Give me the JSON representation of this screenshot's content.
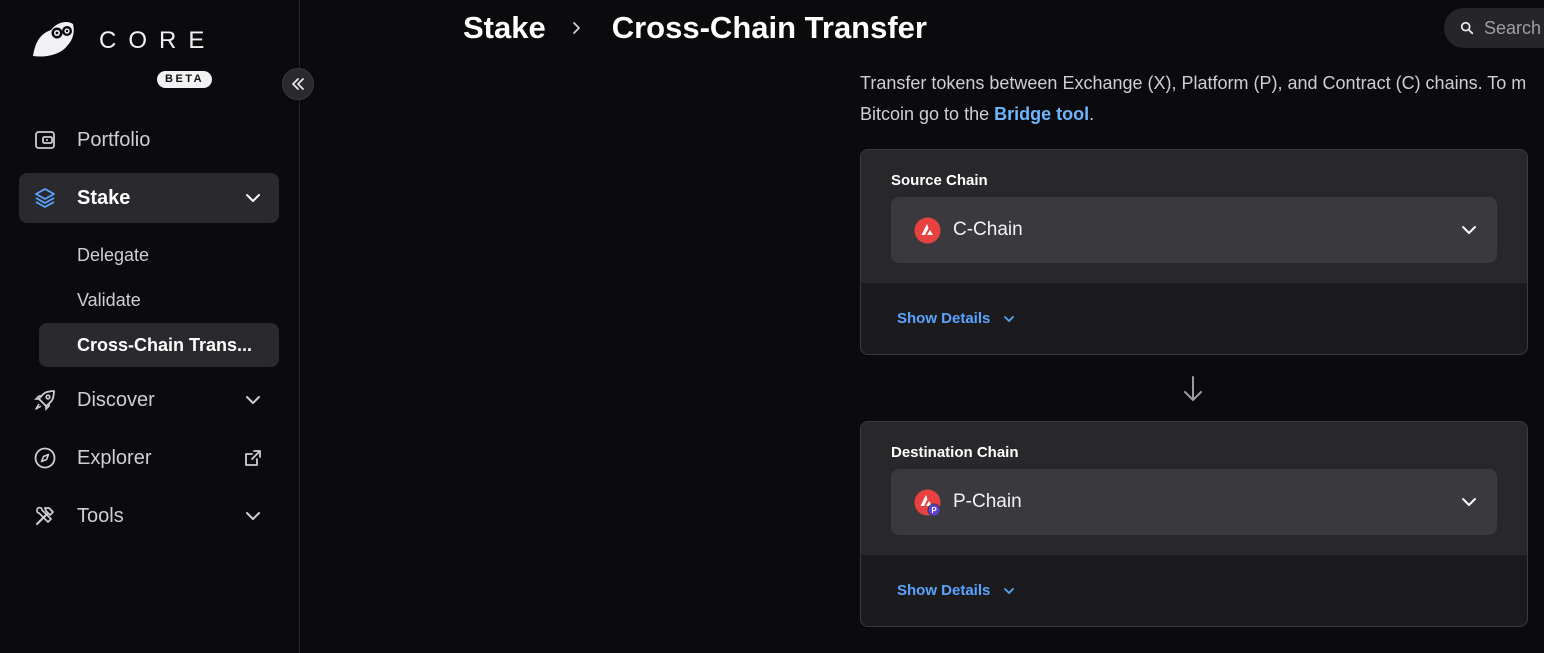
{
  "brand": {
    "name": "CORE",
    "badge": "BETA"
  },
  "sidebar": {
    "items": [
      {
        "label": "Portfolio",
        "icon": "wallet-icon"
      },
      {
        "label": "Stake",
        "icon": "layers-icon",
        "expanded": true,
        "subitems": [
          {
            "label": "Delegate"
          },
          {
            "label": "Validate"
          },
          {
            "label": "Cross-Chain Trans..."
          }
        ]
      },
      {
        "label": "Discover",
        "icon": "rocket-icon"
      },
      {
        "label": "Explorer",
        "icon": "compass-icon"
      },
      {
        "label": "Tools",
        "icon": "tools-icon"
      }
    ]
  },
  "header": {
    "breadcrumb": [
      "Stake",
      "Cross-Chain Transfer"
    ],
    "search_placeholder": "Search"
  },
  "intro": {
    "line1": "Transfer tokens between Exchange (X), Platform (P), and Contract (C) chains. To m",
    "line2_prefix": "Bitcoin go to the ",
    "link": "Bridge tool",
    "line2_suffix": "."
  },
  "source": {
    "label": "Source Chain",
    "value": "C-Chain",
    "details": "Show Details"
  },
  "destination": {
    "label": "Destination Chain",
    "value": "P-Chain",
    "details": "Show Details",
    "badge": "P"
  },
  "colors": {
    "accent": "#5aa3ff",
    "link": "#6fb5ff",
    "avax_red": "#e84142",
    "p_badge": "#5b3fd8"
  }
}
